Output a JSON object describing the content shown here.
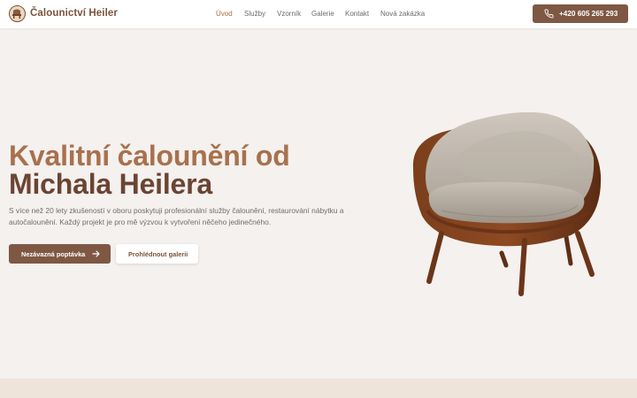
{
  "brand": {
    "name": "Čalounictví Heiler",
    "logo_icon": "chair-emblem-icon"
  },
  "nav": {
    "items": [
      {
        "label": "Úvod",
        "active": true
      },
      {
        "label": "Služby",
        "active": false
      },
      {
        "label": "Vzorník",
        "active": false
      },
      {
        "label": "Galerie",
        "active": false
      },
      {
        "label": "Kontakt",
        "active": false
      },
      {
        "label": "Nová zakázka",
        "active": false
      }
    ]
  },
  "contact": {
    "phone": "+420 605 265 293",
    "icon": "phone-icon"
  },
  "hero": {
    "title_line1": "Kvalitní čalounění od",
    "title_line2": "Michala Heilera",
    "description": "S více než 20 lety zkušeností v oboru poskytuji profesionální služby čalounění, restaurování nábytku a autočalounění. Každý projekt je pro mě výzvou k vytvoření něčeho jedinečného.",
    "primary_button": "Nezávazná poptávka",
    "secondary_button": "Prohlédnout galerii",
    "image": "armchair-image"
  },
  "colors": {
    "accent": "#7f5844",
    "title_light": "#a8714d",
    "title_dark": "#6b4433",
    "background": "#f4f1ef",
    "footer_band": "#eee4da"
  }
}
